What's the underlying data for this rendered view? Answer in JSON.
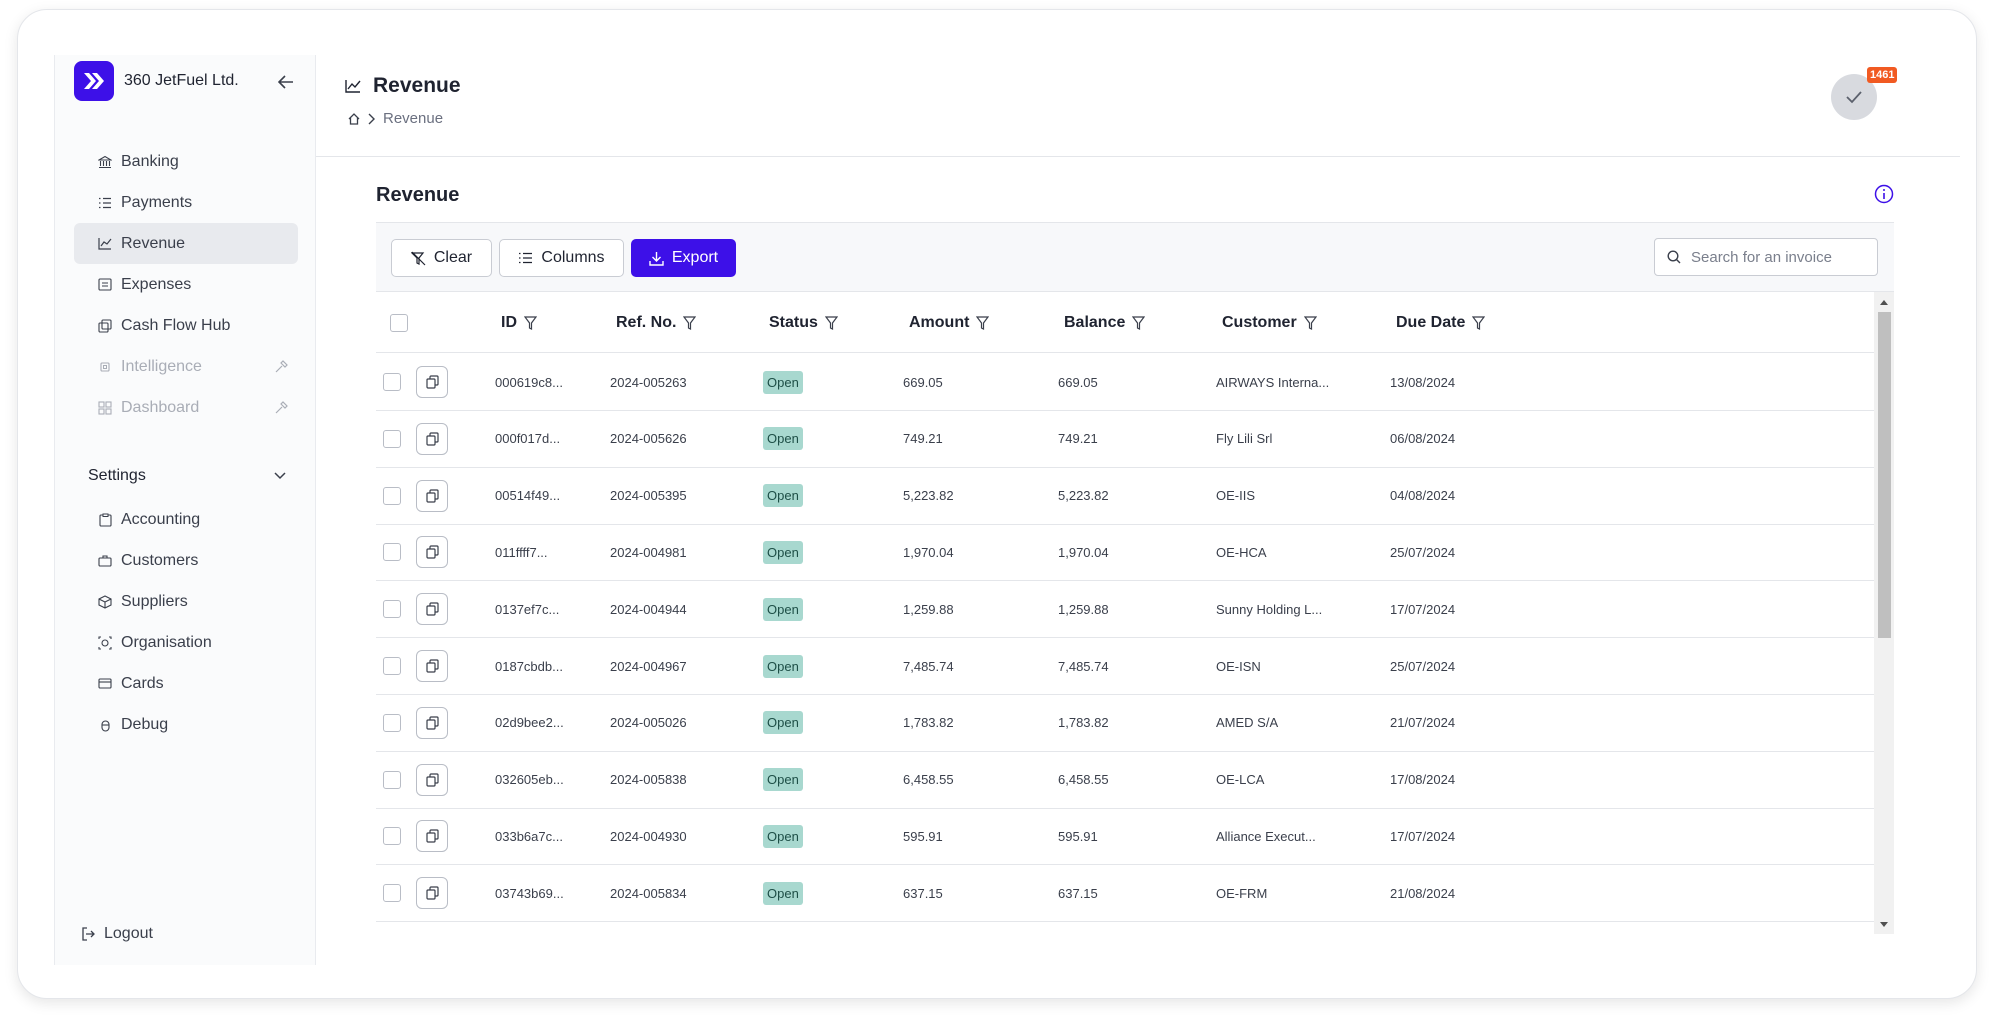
{
  "brand": {
    "name": "360 JetFuel Ltd."
  },
  "nav": [
    {
      "label": "Banking",
      "icon": "bank-icon"
    },
    {
      "label": "Payments",
      "icon": "list-icon"
    },
    {
      "label": "Revenue",
      "icon": "chart-line-icon",
      "active": true
    },
    {
      "label": "Expenses",
      "icon": "receipt-icon"
    },
    {
      "label": "Cash Flow Hub",
      "icon": "copy-icon"
    },
    {
      "label": "Intelligence",
      "icon": "cpu-icon",
      "disabled": true
    },
    {
      "label": "Dashboard",
      "icon": "grid-icon",
      "disabled": true
    }
  ],
  "settings": {
    "label": "Settings",
    "items": [
      {
        "label": "Accounting",
        "icon": "clipboard-icon"
      },
      {
        "label": "Customers",
        "icon": "briefcase-icon"
      },
      {
        "label": "Suppliers",
        "icon": "box-icon"
      },
      {
        "label": "Organisation",
        "icon": "building-icon"
      },
      {
        "label": "Cards",
        "icon": "card-icon"
      },
      {
        "label": "Debug",
        "icon": "bug-icon"
      }
    ]
  },
  "logout_label": "Logout",
  "header": {
    "title": "Revenue",
    "breadcrumb": "Revenue",
    "badge_count": "1461"
  },
  "section_title": "Revenue",
  "toolbar": {
    "clear_label": "Clear",
    "columns_label": "Columns",
    "export_label": "Export",
    "search_placeholder": "Search for an invoice"
  },
  "table": {
    "columns": [
      "ID",
      "Ref. No.",
      "Status",
      "Amount",
      "Balance",
      "Customer",
      "Due Date"
    ],
    "rows": [
      {
        "id": "000619c8...",
        "ref": "2024-005263",
        "status": "Open",
        "amount": "669.05",
        "balance": "669.05",
        "customer": "AIRWAYS Interna...",
        "due": "13/08/2024"
      },
      {
        "id": "000f017d...",
        "ref": "2024-005626",
        "status": "Open",
        "amount": "749.21",
        "balance": "749.21",
        "customer": "Fly Lili Srl",
        "due": "06/08/2024"
      },
      {
        "id": "00514f49...",
        "ref": "2024-005395",
        "status": "Open",
        "amount": "5,223.82",
        "balance": "5,223.82",
        "customer": "OE-IIS",
        "due": "04/08/2024"
      },
      {
        "id": "011ffff7...",
        "ref": "2024-004981",
        "status": "Open",
        "amount": "1,970.04",
        "balance": "1,970.04",
        "customer": "OE-HCA",
        "due": "25/07/2024"
      },
      {
        "id": "0137ef7c...",
        "ref": "2024-004944",
        "status": "Open",
        "amount": "1,259.88",
        "balance": "1,259.88",
        "customer": "Sunny Holding L...",
        "due": "17/07/2024"
      },
      {
        "id": "0187cbdb...",
        "ref": "2024-004967",
        "status": "Open",
        "amount": "7,485.74",
        "balance": "7,485.74",
        "customer": "OE-ISN",
        "due": "25/07/2024"
      },
      {
        "id": "02d9bee2...",
        "ref": "2024-005026",
        "status": "Open",
        "amount": "1,783.82",
        "balance": "1,783.82",
        "customer": "AMED S/A",
        "due": "21/07/2024"
      },
      {
        "id": "032605eb...",
        "ref": "2024-005838",
        "status": "Open",
        "amount": "6,458.55",
        "balance": "6,458.55",
        "customer": "OE-LCA",
        "due": "17/08/2024"
      },
      {
        "id": "033b6a7c...",
        "ref": "2024-004930",
        "status": "Open",
        "amount": "595.91",
        "balance": "595.91",
        "customer": "Alliance Execut...",
        "due": "17/07/2024"
      },
      {
        "id": "03743b69...",
        "ref": "2024-005834",
        "status": "Open",
        "amount": "637.15",
        "balance": "637.15",
        "customer": "OE-FRM",
        "due": "21/08/2024"
      }
    ]
  },
  "colors": {
    "accent": "#3d10e8",
    "badge": "#f15a22",
    "status_bg": "#a8d8cf",
    "active_nav": "#e8eaee"
  }
}
